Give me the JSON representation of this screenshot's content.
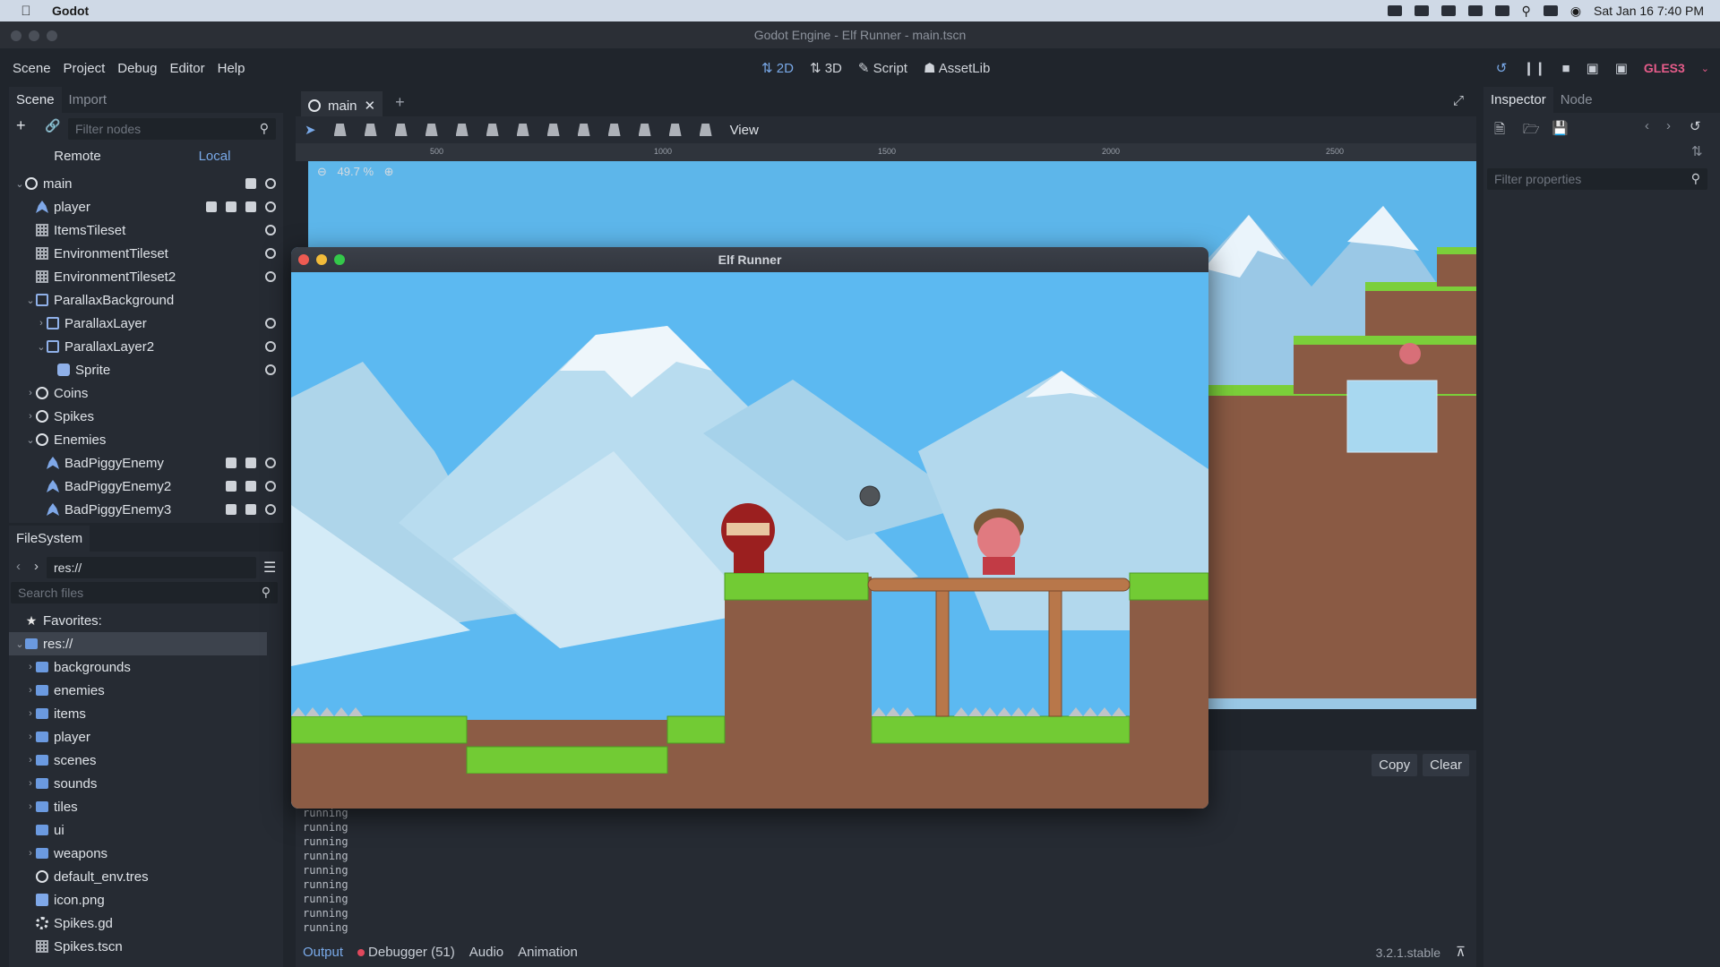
{
  "menubar": {
    "app": "Godot",
    "datetime": "Sat Jan 16  7:40 PM"
  },
  "window_title": "Godot Engine - Elf Runner - main.tscn",
  "menus": [
    "Scene",
    "Project",
    "Debug",
    "Editor",
    "Help"
  ],
  "workspaces": [
    "2D",
    "3D",
    "Script",
    "AssetLib"
  ],
  "renderer": "GLES3",
  "scene_dock": {
    "tabs": [
      "Scene",
      "Import"
    ],
    "filter_placeholder": "Filter nodes",
    "remote": "Remote",
    "local": "Local",
    "nodes": [
      {
        "label": "main",
        "icon": "node"
      },
      {
        "label": "player",
        "icon": "kinematic"
      },
      {
        "label": "ItemsTileset",
        "icon": "tilemap"
      },
      {
        "label": "EnvironmentTileset",
        "icon": "tilemap"
      },
      {
        "label": "EnvironmentTileset2",
        "icon": "tilemap"
      },
      {
        "label": "ParallaxBackground",
        "icon": "parallax"
      },
      {
        "label": "ParallaxLayer",
        "icon": "parallax"
      },
      {
        "label": "ParallaxLayer2",
        "icon": "parallax"
      },
      {
        "label": "Sprite",
        "icon": "sprite"
      },
      {
        "label": "Coins",
        "icon": "node"
      },
      {
        "label": "Spikes",
        "icon": "node"
      },
      {
        "label": "Enemies",
        "icon": "node"
      },
      {
        "label": "BadPiggyEnemy",
        "icon": "kinematic"
      },
      {
        "label": "BadPiggyEnemy2",
        "icon": "kinematic"
      },
      {
        "label": "BadPiggyEnemy3",
        "icon": "kinematic"
      }
    ]
  },
  "filesystem": {
    "title": "FileSystem",
    "path": "res://",
    "search_placeholder": "Search files",
    "favorites": "Favorites:",
    "root": "res://",
    "items": [
      {
        "label": "backgrounds",
        "icon": "folder"
      },
      {
        "label": "enemies",
        "icon": "folder"
      },
      {
        "label": "items",
        "icon": "folder"
      },
      {
        "label": "player",
        "icon": "folder"
      },
      {
        "label": "scenes",
        "icon": "folder"
      },
      {
        "label": "sounds",
        "icon": "folder"
      },
      {
        "label": "tiles",
        "icon": "folder"
      },
      {
        "label": "ui",
        "icon": "folder"
      },
      {
        "label": "weapons",
        "icon": "folder"
      },
      {
        "label": "default_env.tres",
        "icon": "globe"
      },
      {
        "label": "icon.png",
        "icon": "image"
      },
      {
        "label": "Spikes.gd",
        "icon": "gear"
      },
      {
        "label": "Spikes.tscn",
        "icon": "scene"
      }
    ]
  },
  "editor": {
    "scene_tab": "main",
    "view_menu": "View",
    "zoom": "49.7 %",
    "ruler_ticks": [
      "500",
      "1000",
      "1500",
      "2000",
      "2500"
    ]
  },
  "game_window": {
    "title": "Elf Runner"
  },
  "output": {
    "copy": "Copy",
    "clear": "Clear",
    "lines": [
      "running",
      "running",
      "running",
      "running",
      "running",
      "running",
      "running",
      "running",
      "running",
      "running"
    ],
    "tabs": [
      "Output",
      "Debugger (51)",
      "Audio",
      "Animation"
    ],
    "version": "3.2.1.stable"
  },
  "inspector": {
    "tabs": [
      "Inspector",
      "Node"
    ],
    "filter_placeholder": "Filter properties"
  }
}
